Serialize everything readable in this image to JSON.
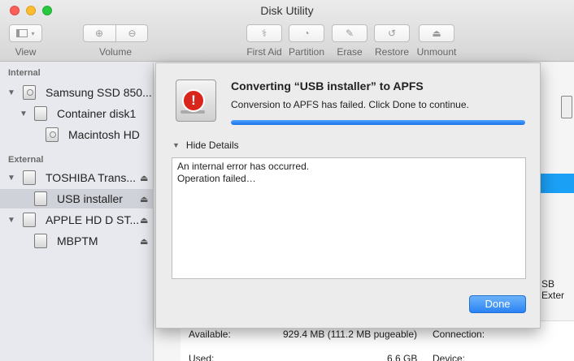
{
  "window": {
    "title": "Disk Utility"
  },
  "toolbar": {
    "view_label": "View",
    "volume_label": "Volume",
    "first_aid_label": "First Aid",
    "partition_label": "Partition",
    "erase_label": "Erase",
    "restore_label": "Restore",
    "unmount_label": "Unmount"
  },
  "sidebar": {
    "internal_header": "Internal",
    "external_header": "External",
    "items": [
      {
        "label": "Samsung SSD 850..."
      },
      {
        "label": "Container disk1"
      },
      {
        "label": "Macintosh HD"
      },
      {
        "label": "TOSHIBA Trans..."
      },
      {
        "label": "USB installer"
      },
      {
        "label": "APPLE HD D ST..."
      },
      {
        "label": "MBPTM"
      }
    ]
  },
  "dialog": {
    "title": "Converting “USB installer” to APFS",
    "message": "Conversion to APFS has failed. Click Done to continue.",
    "progress": 1.0,
    "details_toggle": "Hide Details",
    "log": [
      "An internal error has occurred.",
      "Operation failed…"
    ],
    "done_label": "Done"
  },
  "info": {
    "available_label": "Available:",
    "available_value": "929.4 MB (111.2 MB pugeable)",
    "used_label": "Used:",
    "used_value": "6.6 GB",
    "connection_label": "Connection:",
    "device_label": "Device:",
    "side_text": "SB Exter"
  },
  "colors": {
    "accent": "#2a83f3",
    "selection": "#1aa0f5",
    "alert": "#d9261c"
  }
}
